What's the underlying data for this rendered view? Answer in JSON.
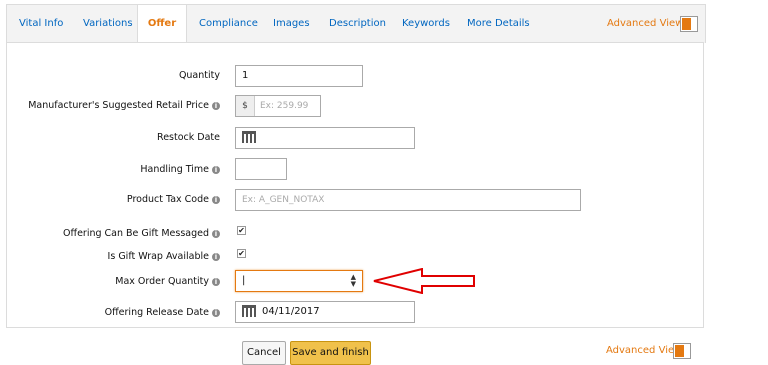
{
  "tabs": [
    {
      "label": "Vital Info"
    },
    {
      "label": "Variations"
    },
    {
      "label": "Offer"
    },
    {
      "label": "Compliance"
    },
    {
      "label": "Images"
    },
    {
      "label": "Description"
    },
    {
      "label": "Keywords"
    },
    {
      "label": "More Details"
    }
  ],
  "active_tab": "Offer",
  "advanced_view_label": "Advanced View",
  "form": {
    "quantity": {
      "label": "Quantity",
      "value": "1"
    },
    "msrp": {
      "label": "Manufacturer's Suggested Retail Price",
      "currency": "$",
      "placeholder": "Ex: 259.99"
    },
    "restock_date": {
      "label": "Restock Date"
    },
    "handling_time": {
      "label": "Handling Time"
    },
    "product_tax_code": {
      "label": "Product Tax Code",
      "placeholder": "Ex: A_GEN_NOTAX"
    },
    "gift_message": {
      "label": "Offering Can Be Gift Messaged",
      "checked": true
    },
    "gift_wrap": {
      "label": "Is Gift Wrap Available",
      "checked": true
    },
    "max_order_qty": {
      "label": "Max Order Quantity",
      "value": ""
    },
    "release_date": {
      "label": "Offering Release Date",
      "value": "04/11/2017"
    }
  },
  "buttons": {
    "cancel": "Cancel",
    "save": "Save and finish"
  },
  "colors": {
    "accent": "#e47911",
    "link": "#0066c0",
    "arrow": "#e00000",
    "save_button": "#f0c14b"
  },
  "icons": {
    "info": "i",
    "check": "✔",
    "spin_up": "▲",
    "spin_down": "▼"
  }
}
